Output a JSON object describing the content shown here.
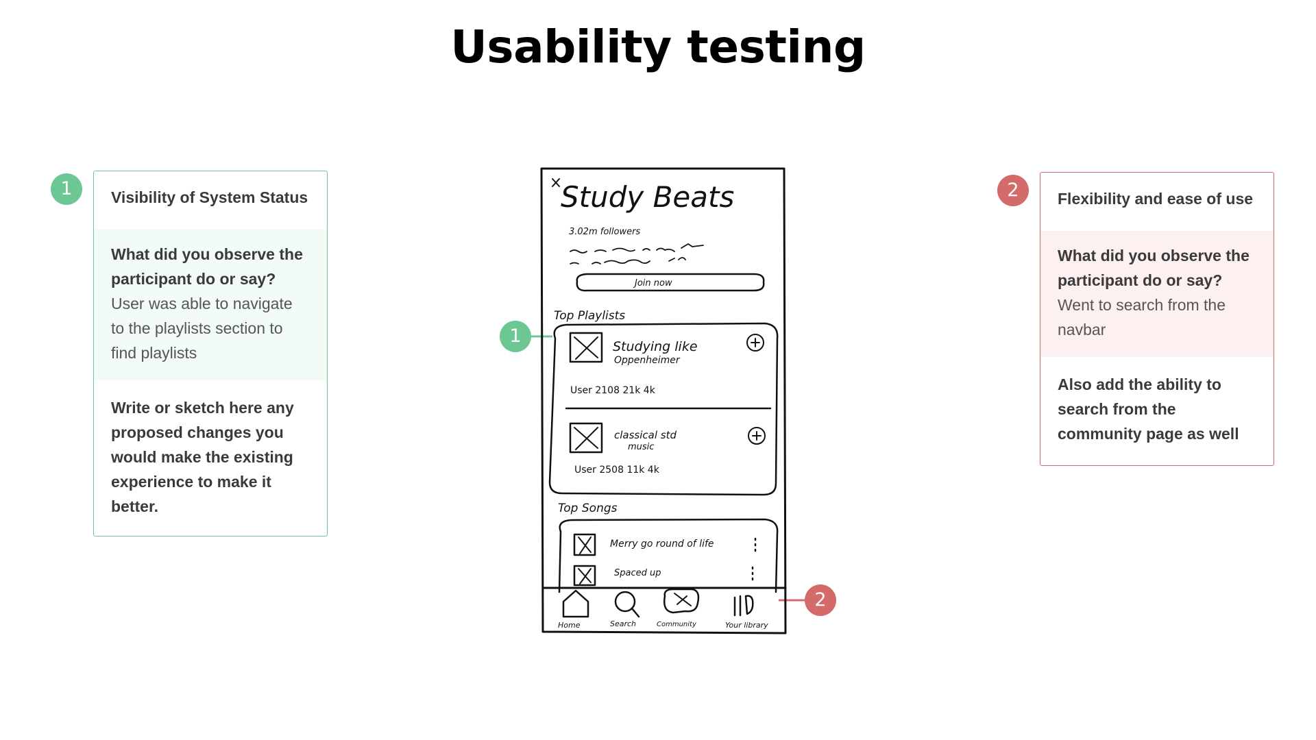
{
  "page": {
    "title": "Usability testing"
  },
  "colors": {
    "green": "#6cc795",
    "red": "#d46a6a",
    "green_bg": "#f2fbf5",
    "red_bg": "#fdf0f0"
  },
  "card_left": {
    "badge": "1",
    "heading": "Visibility of System Status",
    "question": "What did you observe the participant do or say?",
    "observation": "User was able to navigate to the playlists section to find playlists",
    "prompt": "Write or sketch here any proposed changes you would make the existing experience to make it better."
  },
  "card_right": {
    "badge": "2",
    "heading": "Flexibility and ease of use",
    "question": "What did you observe the participant do or say?",
    "observation": "Went to search from the navbar",
    "proposal": "Also add the ability to search from the community page as well"
  },
  "sketch": {
    "title": "Study Beats",
    "followers": "3.02m followers",
    "join_button": "Join now",
    "top_playlists_label": "Top Playlists",
    "playlists": [
      {
        "name": "Studying like",
        "subtitle": "Oppenheimer",
        "meta": "User 2108   21k   4k"
      },
      {
        "name": "classical std",
        "subtitle": "music",
        "meta": "User 2508   11k   4k"
      }
    ],
    "top_songs_label": "Top Songs",
    "songs": [
      "Merry go round of life",
      "Spaced up"
    ],
    "nav": [
      "Home",
      "Search",
      "Community",
      "Your library"
    ],
    "callout_1": "1",
    "callout_2": "2"
  }
}
